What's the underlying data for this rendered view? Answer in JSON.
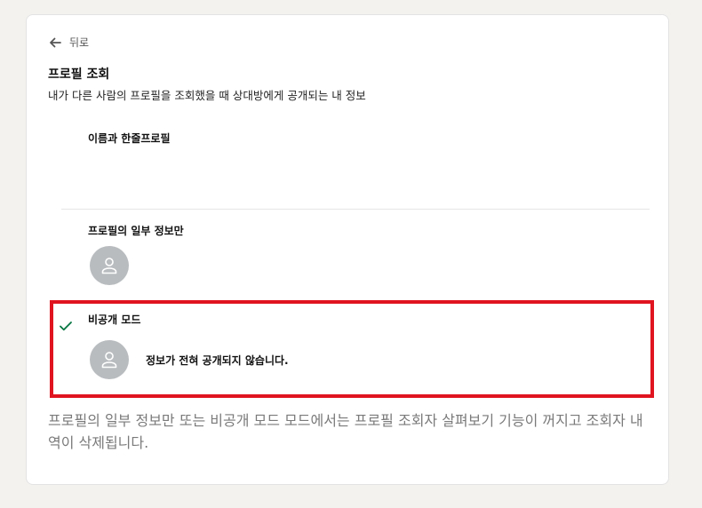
{
  "nav": {
    "back_label": "뒤로",
    "back_icon": "arrow-left-icon"
  },
  "header": {
    "title": "프로필 조회",
    "subtitle": "내가 다른 사람의 프로필을 조회했을 때 상대방에게 공개되는 내 정보"
  },
  "options": [
    {
      "label": "이름과 한줄프로필",
      "selected": false
    },
    {
      "label": "프로필의 일부 정보만",
      "selected": false,
      "avatar_icon": "person-icon"
    },
    {
      "label": "비공개 모드",
      "selected": true,
      "avatar_icon": "person-icon",
      "description": "정보가 전혀 공개되지 않습니다."
    }
  ],
  "footnote": {
    "text": "프로필의 일부 정보만 또는 비공개 모드 모드에서는 프로필 조회자 살펴보기 기능이 꺼지고 조회자 내역이 삭제됩니다."
  },
  "colors": {
    "check": "#057642",
    "highlight": "#e0141f",
    "avatar": "#b9bcbf"
  }
}
